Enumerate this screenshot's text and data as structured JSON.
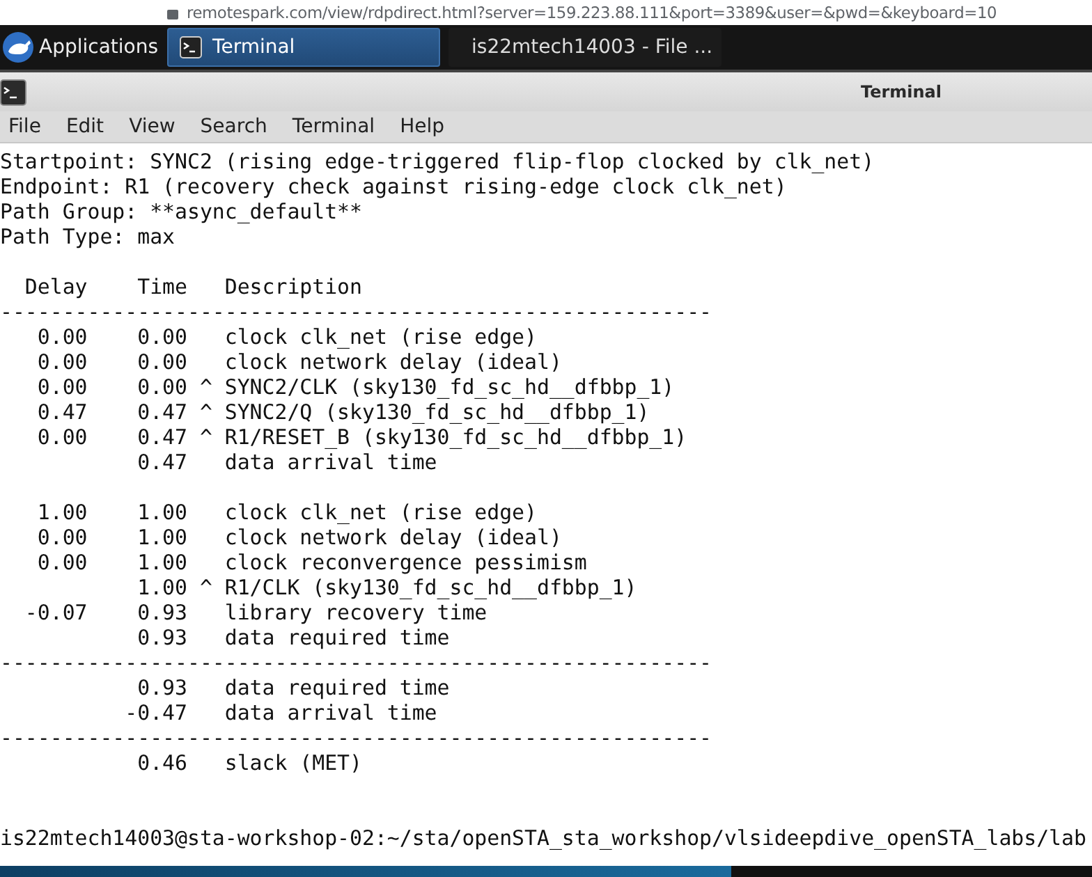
{
  "browser": {
    "address": "remotespark.com/view/rdpdirect.html?server=159.223.88.111&port=3389&user=&pwd=&keyboard=10"
  },
  "taskbar": {
    "menu_label": "Applications",
    "items": [
      {
        "label": "Terminal",
        "kind": "terminal",
        "selected": true
      },
      {
        "label": "is22mtech14003 - File ...",
        "kind": "home",
        "selected": false
      }
    ]
  },
  "window": {
    "title": "Terminal",
    "menu": [
      "File",
      "Edit",
      "View",
      "Search",
      "Terminal",
      "Help"
    ],
    "lines": [
      {
        "kind": "text",
        "text": "Startpoint: SYNC2 (rising edge-triggered flip-flop clocked by clk_net)"
      },
      {
        "kind": "text",
        "text": "Endpoint: R1 (recovery check against rising-edge clock clk_net)"
      },
      {
        "kind": "text",
        "text": "Path Group: **async_default**"
      },
      {
        "kind": "text",
        "text": "Path Type: max"
      },
      {
        "kind": "blank"
      },
      {
        "kind": "text",
        "text": "  Delay    Time   Description"
      },
      {
        "kind": "text",
        "text": "---------------------------------------------------------"
      },
      {
        "kind": "text",
        "text": "   0.00    0.00   clock clk_net (rise edge)"
      },
      {
        "kind": "text",
        "text": "   0.00    0.00   clock network delay (ideal)"
      },
      {
        "kind": "text",
        "text": "   0.00    0.00 ^ SYNC2/CLK (sky130_fd_sc_hd__dfbbp_1)"
      },
      {
        "kind": "text",
        "text": "   0.47    0.47 ^ SYNC2/Q (sky130_fd_sc_hd__dfbbp_1)"
      },
      {
        "kind": "text",
        "text": "   0.00    0.47 ^ R1/RESET_B (sky130_fd_sc_hd__dfbbp_1)"
      },
      {
        "kind": "text",
        "text": "           0.47   data arrival time"
      },
      {
        "kind": "blank"
      },
      {
        "kind": "text",
        "text": "   1.00    1.00   clock clk_net (rise edge)"
      },
      {
        "kind": "text",
        "text": "   0.00    1.00   clock network delay (ideal)"
      },
      {
        "kind": "text",
        "text": "   0.00    1.00   clock reconvergence pessimism"
      },
      {
        "kind": "text",
        "text": "           1.00 ^ R1/CLK (sky130_fd_sc_hd__dfbbp_1)"
      },
      {
        "kind": "text",
        "text": "  -0.07    0.93   library recovery time"
      },
      {
        "kind": "text",
        "text": "           0.93   data required time"
      },
      {
        "kind": "text",
        "text": "---------------------------------------------------------"
      },
      {
        "kind": "text",
        "text": "           0.93   data required time"
      },
      {
        "kind": "text",
        "text": "          -0.47   data arrival time"
      },
      {
        "kind": "text",
        "text": "---------------------------------------------------------"
      },
      {
        "kind": "text",
        "text": "           0.46   slack (MET)"
      },
      {
        "kind": "blank"
      },
      {
        "kind": "blank"
      },
      {
        "kind": "text",
        "text": "is22mtech14003@sta-workshop-02:~/sta/openSTA_sta_workshop/vlsideepdive_openSTA_labs/lab"
      }
    ]
  }
}
